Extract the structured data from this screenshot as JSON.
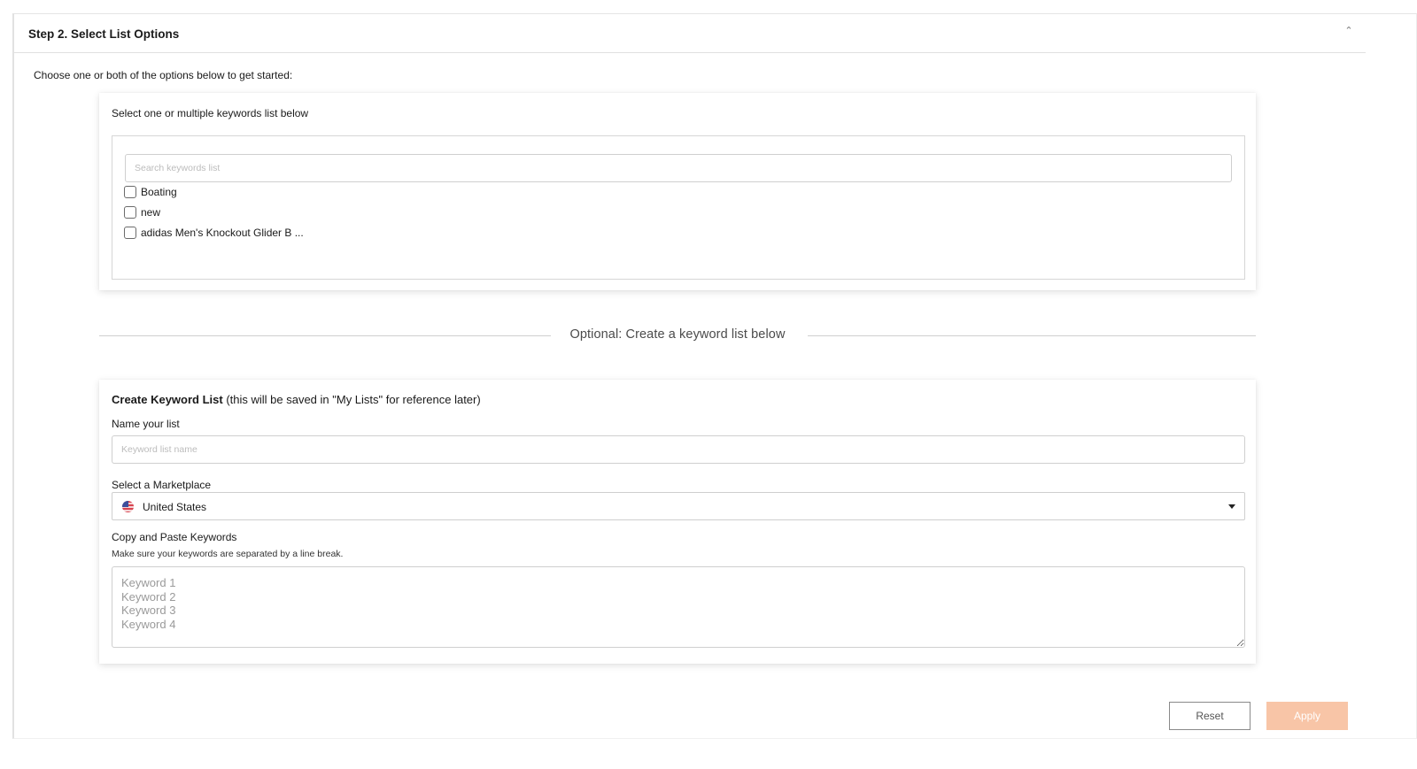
{
  "panel": {
    "title": "Step 2. Select List Options",
    "collapse_icon": "chevron-up-icon",
    "intro": "Choose one or both of the options below to get started:"
  },
  "select_card": {
    "title": "Select one or multiple keywords list below",
    "search_placeholder": "Search keywords list",
    "items": [
      {
        "label": "Boating",
        "checked": false
      },
      {
        "label": "new",
        "checked": false
      },
      {
        "label": "adidas Men's Knockout Glider B ...",
        "checked": false
      }
    ]
  },
  "divider": {
    "text": "Optional: Create a keyword list below"
  },
  "create_card": {
    "title_bold": "Create Keyword List",
    "title_rest": " (this will be saved in \"My Lists\" for reference later)",
    "name_label": "Name your list",
    "name_placeholder": "Keyword list name",
    "marketplace_label": "Select a Marketplace",
    "marketplace_value": "United States",
    "marketplace_icon": "us-flag-icon",
    "keywords_label": "Copy and Paste Keywords",
    "keywords_help": "Make sure your keywords are separated by a line break.",
    "keywords_placeholder": "Keyword 1\nKeyword 2\nKeyword 3\nKeyword 4"
  },
  "actions": {
    "reset_label": "Reset",
    "apply_label": "Apply",
    "apply_color": "#f8c5a7"
  }
}
